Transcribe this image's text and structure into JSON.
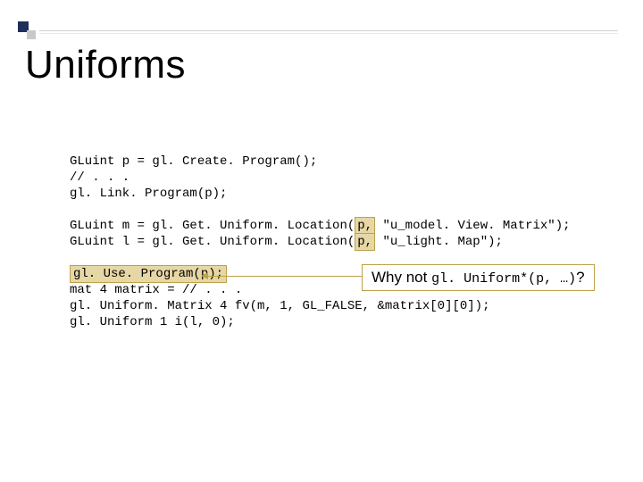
{
  "title": "Uniforms",
  "code": {
    "l1a": "GLuint p = gl. Create. Program();",
    "l2": "// . . .",
    "l3": "gl. Link. Program(p);",
    "l4": "",
    "l5a": "GLuint m = gl. Get. Uniform. Location(",
    "l5p": "p,",
    "l5b": " \"u_model. View. Matrix\");",
    "l6a": "GLuint l = gl. Get. Uniform. Location(",
    "l6p": "p,",
    "l6b": " \"u_light. Map\");",
    "l7": "",
    "l8u": "gl. Use. Program(p);",
    "l9": "mat 4 matrix = // . . .",
    "l10": "gl. Uniform. Matrix 4 fv(m, 1, GL_FALSE, &matrix[0][0]);",
    "l11": "gl. Uniform 1 i(l, 0);"
  },
  "callout": {
    "prefix": "Why not ",
    "mono": "gl. Uniform*(p, …)",
    "suffix": "?"
  }
}
